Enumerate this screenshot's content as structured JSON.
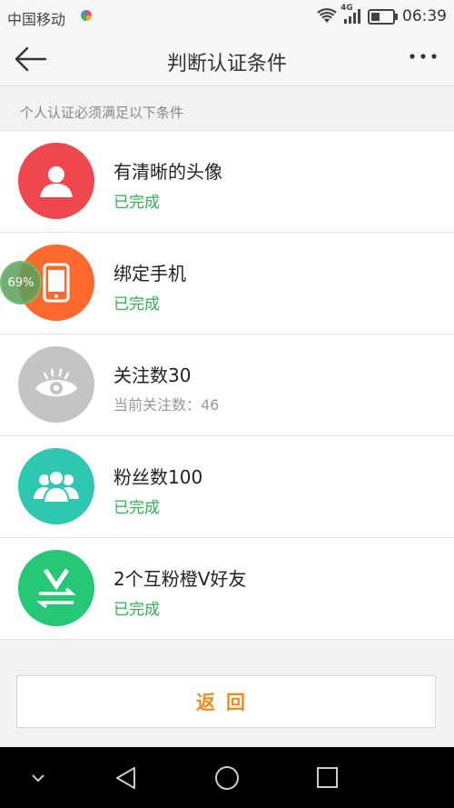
{
  "status_bar": {
    "carrier": "中国移动",
    "network": "4G",
    "time": "06:39"
  },
  "header": {
    "title": "判断认证条件",
    "back_icon": "arrow-left-icon",
    "more_icon": "more-dots-icon"
  },
  "subtitle": "个人认证必须满足以下条件",
  "float_badge": "69%",
  "conditions": [
    {
      "name": "有清晰的头像",
      "status": "已完成",
      "icon": "avatar-icon",
      "color": "#f0474f"
    },
    {
      "name": "绑定手机",
      "status": "已完成",
      "icon": "phone-icon",
      "color": "#fb6a2c"
    },
    {
      "name": "关注数30",
      "status": "当前关注数：46",
      "icon": "eye-icon",
      "color": "#c4c4c4"
    },
    {
      "name": "粉丝数100",
      "status": "已完成",
      "icon": "fans-icon",
      "color": "#2ec7b0"
    },
    {
      "name": "2个互粉橙V好友",
      "status": "已完成",
      "icon": "mutual-follow-icon",
      "color": "#26c876"
    }
  ],
  "return_button": "返回",
  "colors": {
    "completed": "#2bb34f",
    "return_text": "#f08a1c"
  }
}
